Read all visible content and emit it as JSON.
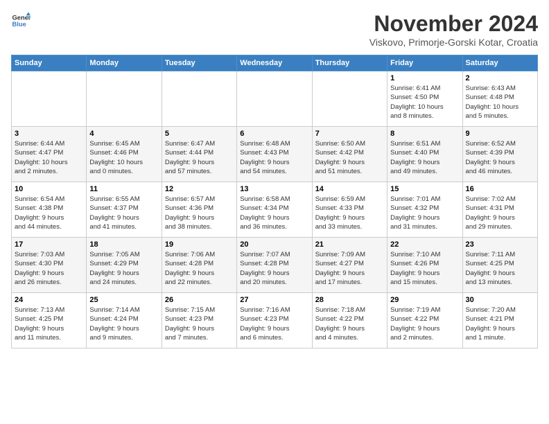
{
  "logo": {
    "general": "General",
    "blue": "Blue"
  },
  "header": {
    "month": "November 2024",
    "location": "Viskovo, Primorje-Gorski Kotar, Croatia"
  },
  "columns": [
    "Sunday",
    "Monday",
    "Tuesday",
    "Wednesday",
    "Thursday",
    "Friday",
    "Saturday"
  ],
  "weeks": [
    [
      {
        "day": "",
        "info": ""
      },
      {
        "day": "",
        "info": ""
      },
      {
        "day": "",
        "info": ""
      },
      {
        "day": "",
        "info": ""
      },
      {
        "day": "",
        "info": ""
      },
      {
        "day": "1",
        "info": "Sunrise: 6:41 AM\nSunset: 4:50 PM\nDaylight: 10 hours\nand 8 minutes."
      },
      {
        "day": "2",
        "info": "Sunrise: 6:43 AM\nSunset: 4:48 PM\nDaylight: 10 hours\nand 5 minutes."
      }
    ],
    [
      {
        "day": "3",
        "info": "Sunrise: 6:44 AM\nSunset: 4:47 PM\nDaylight: 10 hours\nand 2 minutes."
      },
      {
        "day": "4",
        "info": "Sunrise: 6:45 AM\nSunset: 4:46 PM\nDaylight: 10 hours\nand 0 minutes."
      },
      {
        "day": "5",
        "info": "Sunrise: 6:47 AM\nSunset: 4:44 PM\nDaylight: 9 hours\nand 57 minutes."
      },
      {
        "day": "6",
        "info": "Sunrise: 6:48 AM\nSunset: 4:43 PM\nDaylight: 9 hours\nand 54 minutes."
      },
      {
        "day": "7",
        "info": "Sunrise: 6:50 AM\nSunset: 4:42 PM\nDaylight: 9 hours\nand 51 minutes."
      },
      {
        "day": "8",
        "info": "Sunrise: 6:51 AM\nSunset: 4:40 PM\nDaylight: 9 hours\nand 49 minutes."
      },
      {
        "day": "9",
        "info": "Sunrise: 6:52 AM\nSunset: 4:39 PM\nDaylight: 9 hours\nand 46 minutes."
      }
    ],
    [
      {
        "day": "10",
        "info": "Sunrise: 6:54 AM\nSunset: 4:38 PM\nDaylight: 9 hours\nand 44 minutes."
      },
      {
        "day": "11",
        "info": "Sunrise: 6:55 AM\nSunset: 4:37 PM\nDaylight: 9 hours\nand 41 minutes."
      },
      {
        "day": "12",
        "info": "Sunrise: 6:57 AM\nSunset: 4:36 PM\nDaylight: 9 hours\nand 38 minutes."
      },
      {
        "day": "13",
        "info": "Sunrise: 6:58 AM\nSunset: 4:34 PM\nDaylight: 9 hours\nand 36 minutes."
      },
      {
        "day": "14",
        "info": "Sunrise: 6:59 AM\nSunset: 4:33 PM\nDaylight: 9 hours\nand 33 minutes."
      },
      {
        "day": "15",
        "info": "Sunrise: 7:01 AM\nSunset: 4:32 PM\nDaylight: 9 hours\nand 31 minutes."
      },
      {
        "day": "16",
        "info": "Sunrise: 7:02 AM\nSunset: 4:31 PM\nDaylight: 9 hours\nand 29 minutes."
      }
    ],
    [
      {
        "day": "17",
        "info": "Sunrise: 7:03 AM\nSunset: 4:30 PM\nDaylight: 9 hours\nand 26 minutes."
      },
      {
        "day": "18",
        "info": "Sunrise: 7:05 AM\nSunset: 4:29 PM\nDaylight: 9 hours\nand 24 minutes."
      },
      {
        "day": "19",
        "info": "Sunrise: 7:06 AM\nSunset: 4:28 PM\nDaylight: 9 hours\nand 22 minutes."
      },
      {
        "day": "20",
        "info": "Sunrise: 7:07 AM\nSunset: 4:28 PM\nDaylight: 9 hours\nand 20 minutes."
      },
      {
        "day": "21",
        "info": "Sunrise: 7:09 AM\nSunset: 4:27 PM\nDaylight: 9 hours\nand 17 minutes."
      },
      {
        "day": "22",
        "info": "Sunrise: 7:10 AM\nSunset: 4:26 PM\nDaylight: 9 hours\nand 15 minutes."
      },
      {
        "day": "23",
        "info": "Sunrise: 7:11 AM\nSunset: 4:25 PM\nDaylight: 9 hours\nand 13 minutes."
      }
    ],
    [
      {
        "day": "24",
        "info": "Sunrise: 7:13 AM\nSunset: 4:25 PM\nDaylight: 9 hours\nand 11 minutes."
      },
      {
        "day": "25",
        "info": "Sunrise: 7:14 AM\nSunset: 4:24 PM\nDaylight: 9 hours\nand 9 minutes."
      },
      {
        "day": "26",
        "info": "Sunrise: 7:15 AM\nSunset: 4:23 PM\nDaylight: 9 hours\nand 7 minutes."
      },
      {
        "day": "27",
        "info": "Sunrise: 7:16 AM\nSunset: 4:23 PM\nDaylight: 9 hours\nand 6 minutes."
      },
      {
        "day": "28",
        "info": "Sunrise: 7:18 AM\nSunset: 4:22 PM\nDaylight: 9 hours\nand 4 minutes."
      },
      {
        "day": "29",
        "info": "Sunrise: 7:19 AM\nSunset: 4:22 PM\nDaylight: 9 hours\nand 2 minutes."
      },
      {
        "day": "30",
        "info": "Sunrise: 7:20 AM\nSunset: 4:21 PM\nDaylight: 9 hours\nand 1 minute."
      }
    ]
  ]
}
